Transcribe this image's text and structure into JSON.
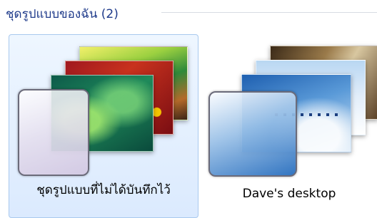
{
  "group": {
    "title": "ชุดรูปแบบของฉัน (2)"
  },
  "themes": [
    {
      "label": "ชุดรูปแบบที่ไม่ได้บันทึกไว้",
      "selected": true
    },
    {
      "label": "Dave's desktop",
      "selected": false
    }
  ]
}
